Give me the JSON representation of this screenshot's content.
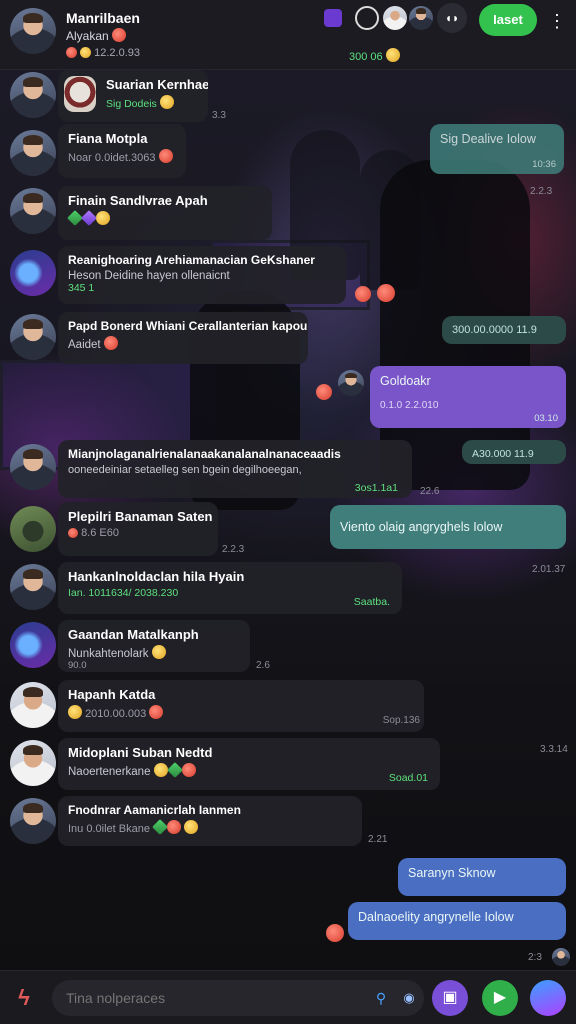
{
  "header": {
    "title": "Manrilbaen",
    "subtitle": "Alyakan",
    "meta": "12.2.0.93",
    "badge": "300 06",
    "join_label": "Iaset",
    "more_label": "⋮"
  },
  "messages": [
    {
      "name": "Suarian Kernhae",
      "text": "Sig Dodeis",
      "time": "3.3"
    },
    {
      "name": "Fiana Motpla",
      "text": "Noar 0.0idet.3063",
      "time": ""
    },
    {
      "name": "Finain Sandlvrae Apah",
      "text": "",
      "time": ""
    },
    {
      "name": "Reanighoaring Arehiamanacian GeKshaner",
      "text": "Heson  Deidine hayen ollenaicnt",
      "green": "345 1",
      "time": ""
    },
    {
      "name": "Papd Bonerd Whiani Cerallanterian kapour",
      "text": "Aaidet",
      "time": ""
    },
    {
      "name": "Mianjnolaganalrienalanaakanalanalnanaceaadis",
      "text": "ooneedeiniar setaelleg sen bgein degilhoeegan,",
      "green": "3os1.1a1",
      "time": "22.6"
    },
    {
      "name": "Plepilri Banaman Saten",
      "text": "8.6 E60",
      "time": "2.2.3"
    },
    {
      "name": "Hankanlnoldaclan hila Hyain",
      "text": "Ian.   1011634/ 2038.230",
      "green": "Saatba.",
      "time": ""
    },
    {
      "name": "Gaandan Matalkanph",
      "text": "Nunkahtenolark",
      "meta": "90.0",
      "time": "2.6"
    },
    {
      "name": "Hapanh Katda",
      "text": "2010.00.003",
      "green": "Sop.136",
      "time": ""
    },
    {
      "name": "Midoplani Suban Nedtd",
      "text": "Naoertenerkane",
      "green": "Soad.01",
      "time": ""
    },
    {
      "name": "Fnodnrar Aamanicrlah Ianmen",
      "text": "Inu 0.0ilet Bkane",
      "time": "2.21"
    }
  ],
  "outgoing": [
    {
      "text": "Sig Dealive  Iolow",
      "time": "10:36"
    },
    {
      "text": "300.00.0000  11.9",
      "time": ""
    },
    {
      "text": "Goldoakr",
      "sub": "0.1.0 2.2.010",
      "time": "03.10"
    },
    {
      "text": "A30.000  11.9",
      "time": ""
    },
    {
      "text": "Viento olaig  angryghels  Iolow",
      "time": ""
    },
    {
      "text": "Saranyn Sknow",
      "time": ""
    },
    {
      "text": "Dalnaoelity angrynelle  Iolow",
      "time": ""
    }
  ],
  "side_times": [
    "2.2.3",
    "2.01.37",
    "3.3.14",
    "2:3"
  ],
  "composer": {
    "placeholder": "Tina nolperaces"
  }
}
